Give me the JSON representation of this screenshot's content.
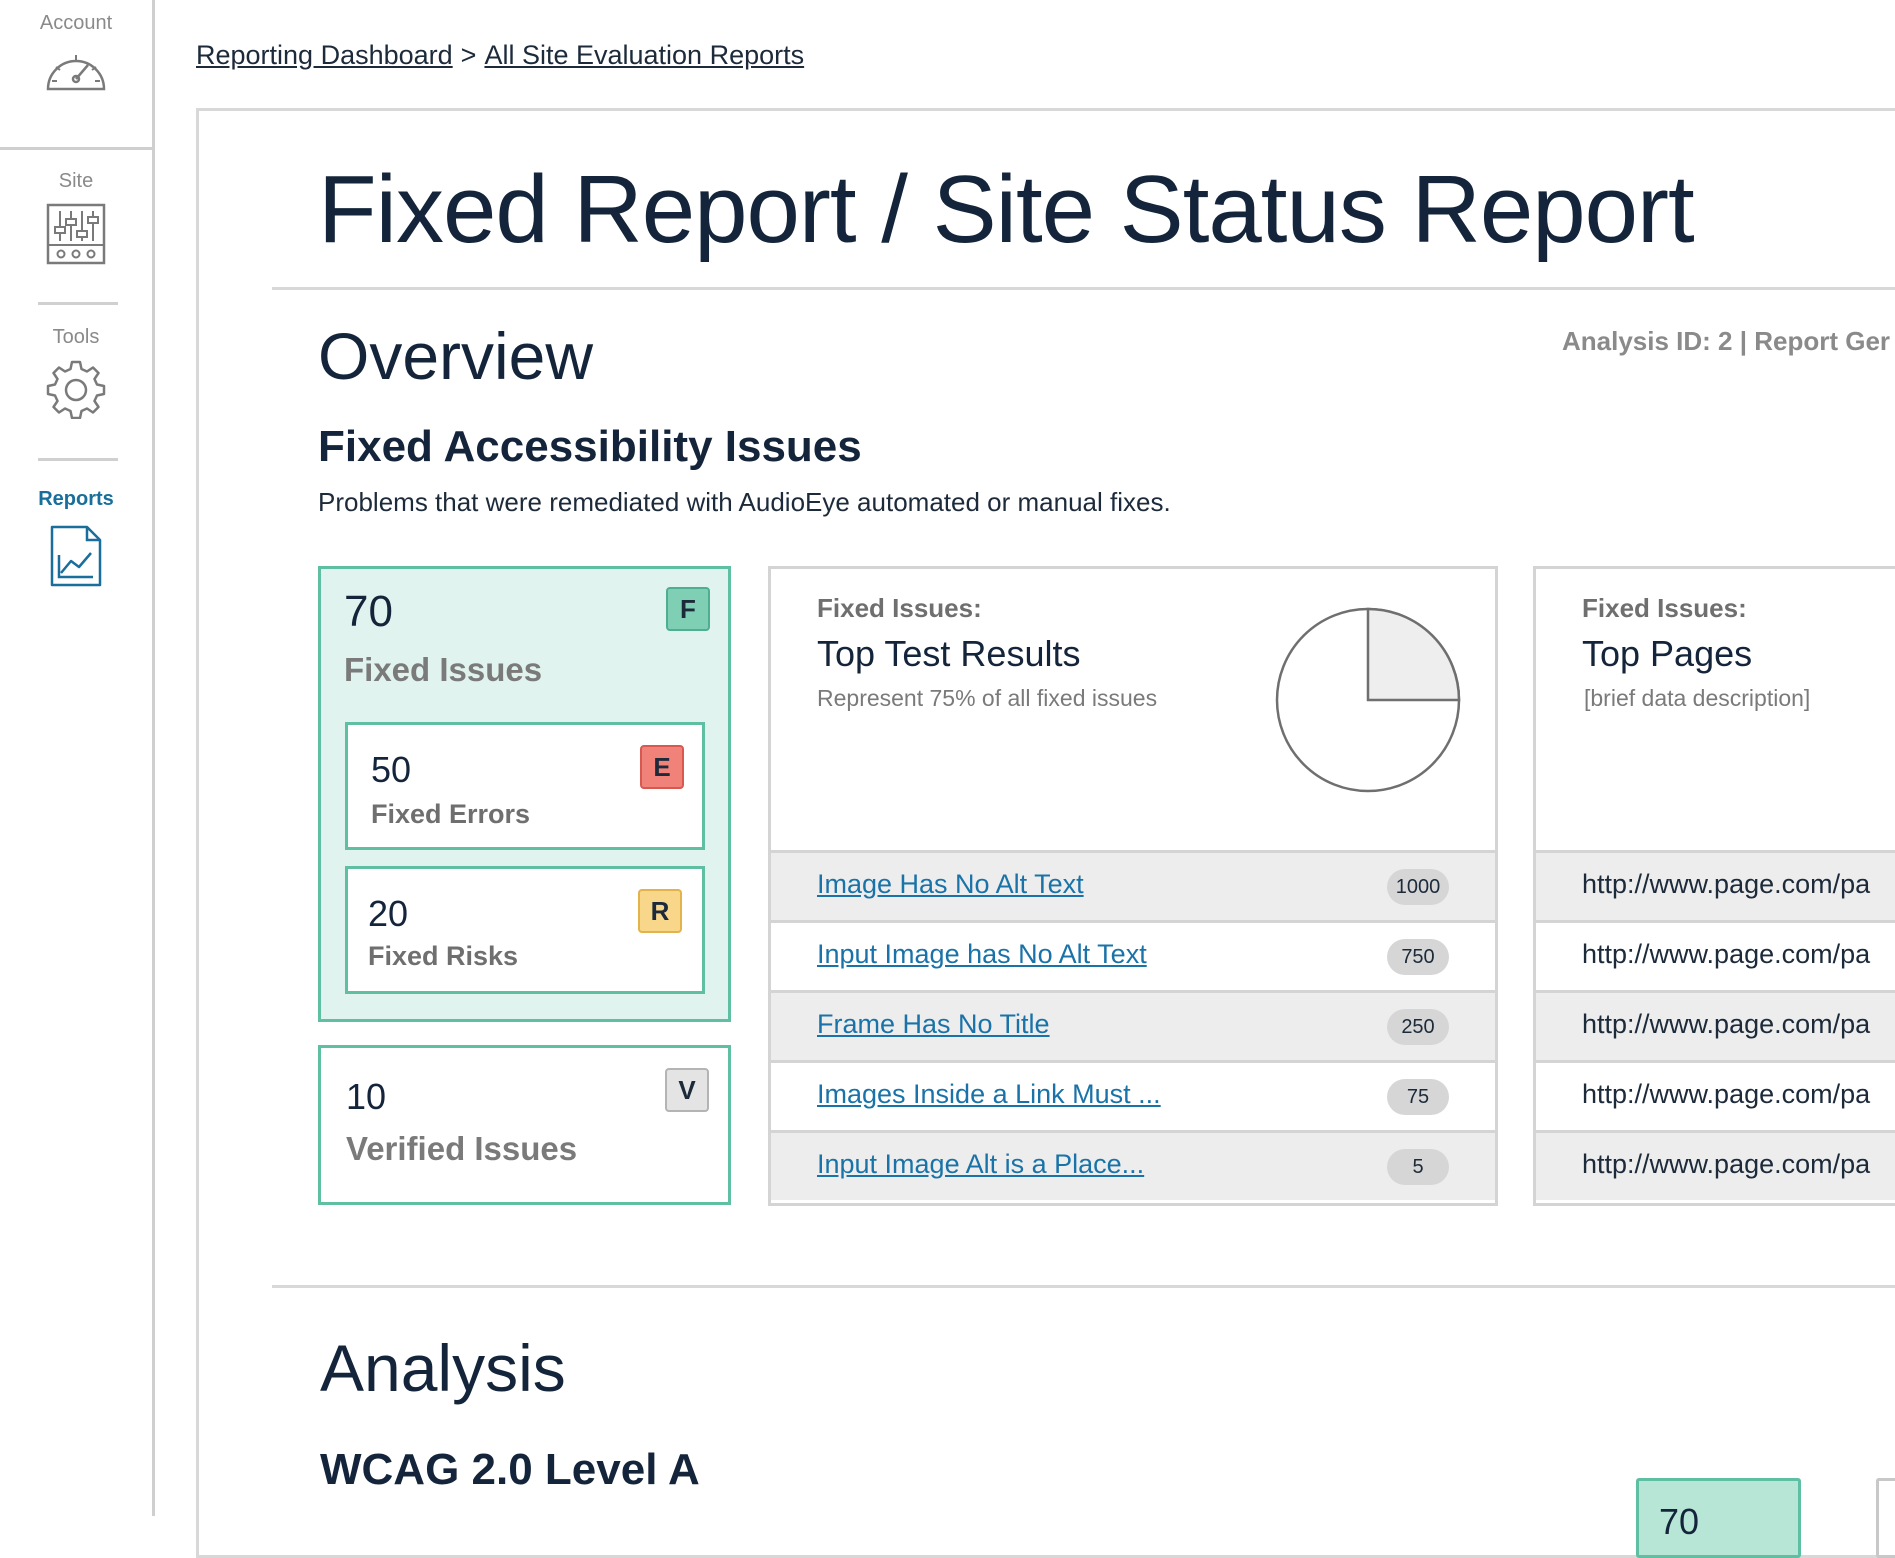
{
  "sidebar": {
    "account_label": "Account",
    "site_label": "Site",
    "tools_label": "Tools",
    "reports_label": "Reports",
    "active": "Reports",
    "accent_color": "#1a6e9b"
  },
  "breadcrumb": {
    "items": [
      "Reporting Dashboard",
      "All Site Evaluation Reports"
    ],
    "separator": ">"
  },
  "page": {
    "title": "Fixed Report / Site Status Report",
    "overview_title": "Overview",
    "analysis_meta": "Analysis ID: 2 | Report Ger"
  },
  "fixed_section": {
    "title": "Fixed Accessibility Issues",
    "subtitle": "Problems that were remediated with AudioEye automated or manual fixes."
  },
  "stats": {
    "fixed": {
      "value": "70",
      "label": "Fixed Issues",
      "badge": "F"
    },
    "errors": {
      "value": "50",
      "label": "Fixed Errors",
      "badge": "E"
    },
    "risks": {
      "value": "20",
      "label": "Fixed Risks",
      "badge": "R"
    },
    "verified": {
      "value": "10",
      "label": "Verified Issues",
      "badge": "V"
    }
  },
  "top_tests": {
    "kicker": "Fixed Issues:",
    "heading": "Top Test Results",
    "description": "Represent 75% of all fixed issues",
    "pie_share": 0.25,
    "rows": [
      {
        "label": "Image Has No Alt Text",
        "count": "1000"
      },
      {
        "label": "Input Image has No Alt Text",
        "count": "750"
      },
      {
        "label": "Frame Has No Title",
        "count": "250"
      },
      {
        "label": "Images Inside a Link Must ...",
        "count": "75"
      },
      {
        "label": "Input Image Alt is a Place...",
        "count": "5"
      }
    ]
  },
  "top_pages": {
    "kicker": "Fixed Issues:",
    "heading": "Top Pages",
    "description": "[brief data description]",
    "rows": [
      {
        "url": "http://www.page.com/pa"
      },
      {
        "url": "http://www.page.com/pa"
      },
      {
        "url": "http://www.page.com/pa"
      },
      {
        "url": "http://www.page.com/pa"
      },
      {
        "url": "http://www.page.com/pa"
      }
    ]
  },
  "analysis": {
    "title": "Analysis",
    "wcag_title": "WCAG 2.0 Level A",
    "card_value": "70"
  },
  "colors": {
    "fixed_bg": "#e0f3ee",
    "fixed_border": "#5fbfa3",
    "error_badge": "#f0827a",
    "risk_badge": "#f8d68a",
    "verified_badge": "#e4e4e4",
    "link": "#1a73a8"
  }
}
